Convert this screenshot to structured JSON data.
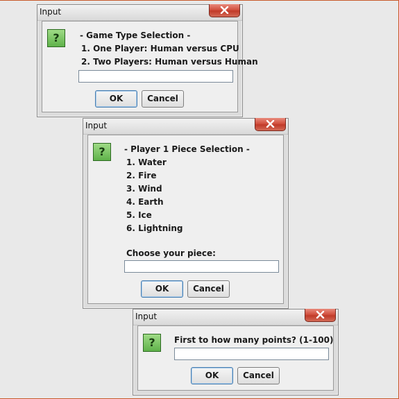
{
  "dialogs": [
    {
      "title": "Input",
      "lines": [
        "- Game Type Selection -",
        "1. One Player: Human versus CPU",
        "2. Two Players: Human versus Human"
      ],
      "input_value": "",
      "ok_label": "OK",
      "cancel_label": "Cancel"
    },
    {
      "title": "Input",
      "lines": [
        "- Player 1 Piece Selection -",
        "1. Water",
        "2. Fire",
        "3. Wind",
        "4. Earth",
        "5. Ice",
        "6. Lightning",
        "Choose your piece:"
      ],
      "input_value": "",
      "ok_label": "OK",
      "cancel_label": "Cancel"
    },
    {
      "title": "Input",
      "lines": [
        "First to how many points? (1-100)"
      ],
      "input_value": "",
      "ok_label": "OK",
      "cancel_label": "Cancel"
    }
  ],
  "icons": {
    "question": "?",
    "close": "close-icon"
  },
  "colors": {
    "close_button": "#c13a29",
    "question_icon": "#5fb24a",
    "default_button_border": "#4a7fb0"
  }
}
